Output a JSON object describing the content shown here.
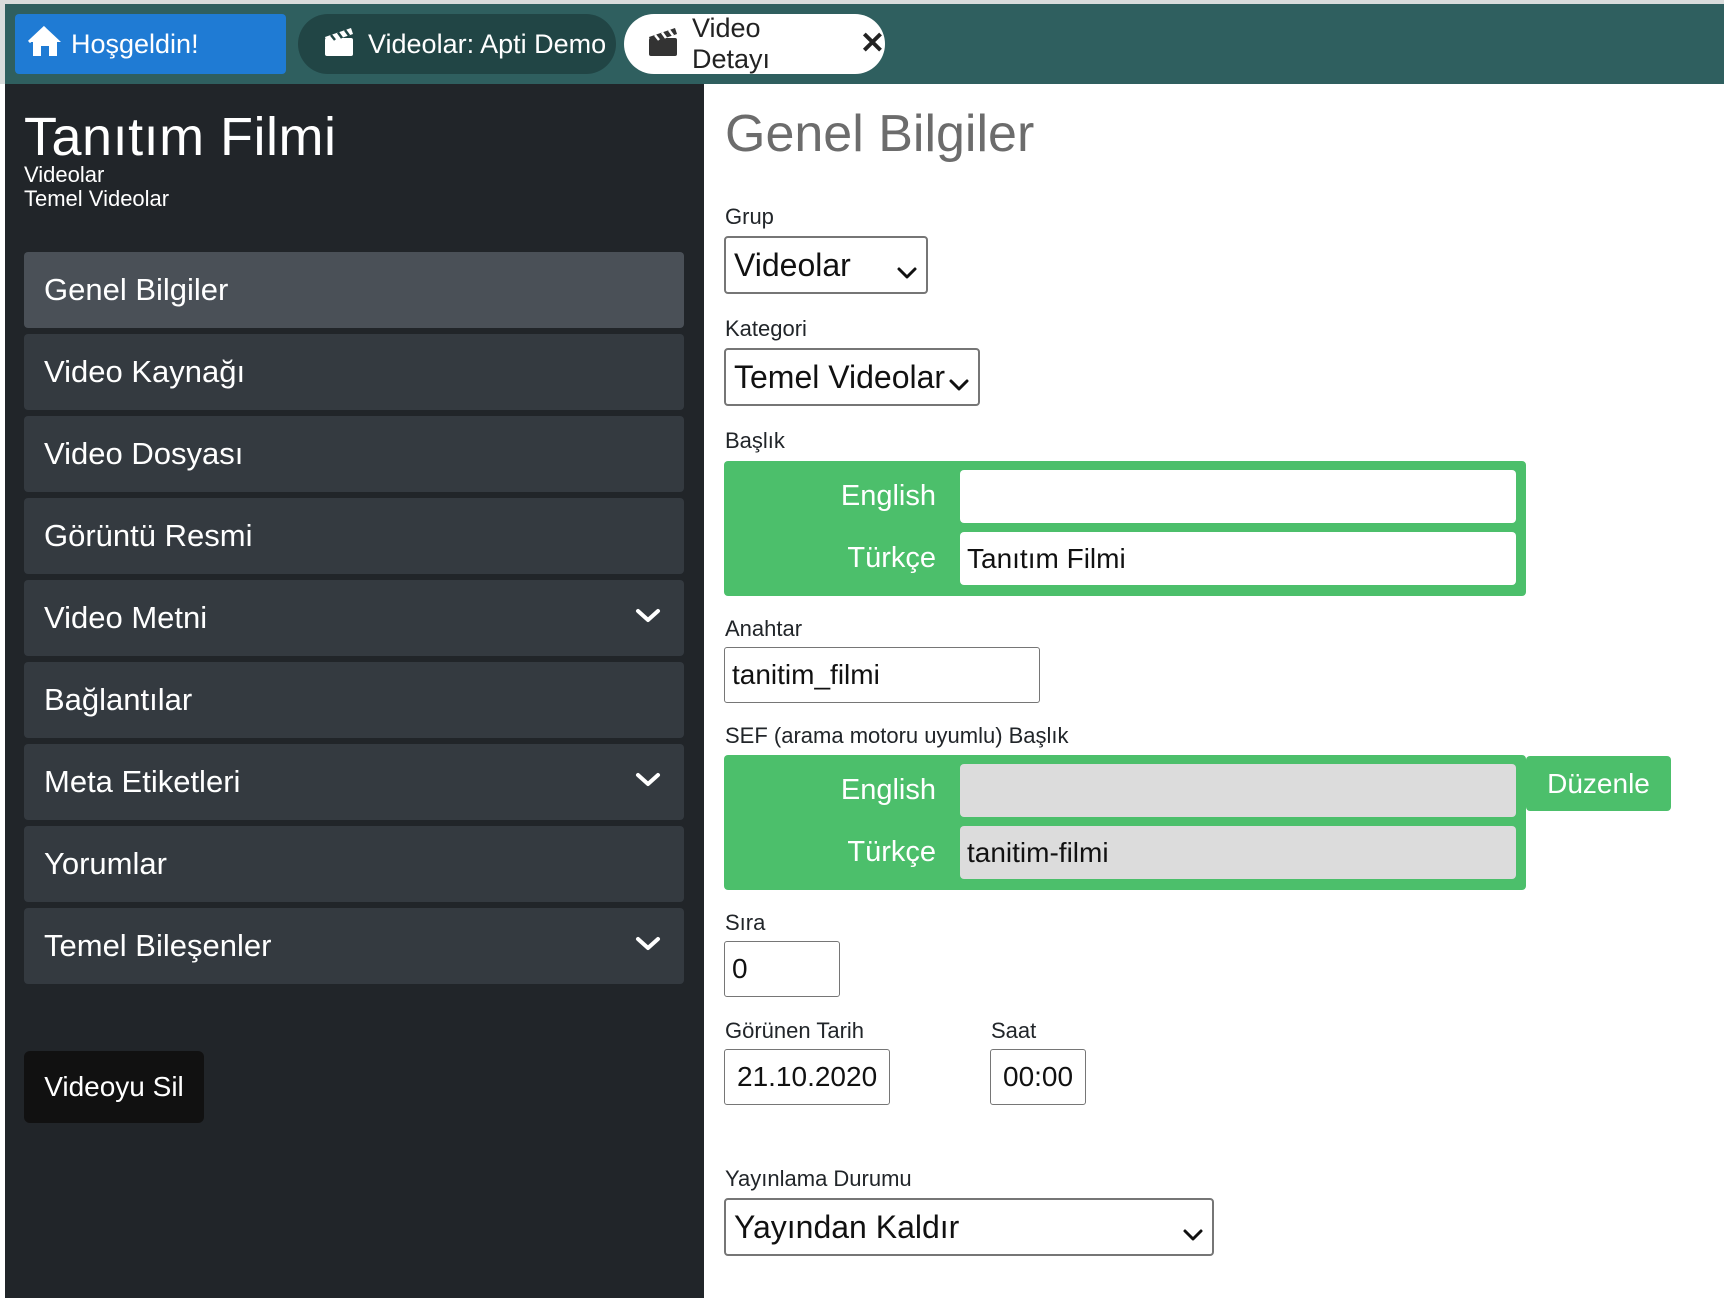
{
  "tabs": {
    "home": "Hoşgeldin!",
    "videos": "Videolar: Apti Demo",
    "detail": "Video Detayı",
    "detail_close": "✕"
  },
  "sidebar": {
    "title": "Tanıtım Filmi",
    "subtitle1": "Videolar",
    "subtitle2": "Temel Videolar",
    "items": [
      {
        "label": "Genel Bilgiler",
        "active": true
      },
      {
        "label": "Video Kaynağı"
      },
      {
        "label": "Video Dosyası"
      },
      {
        "label": "Görüntü Resmi"
      },
      {
        "label": "Video Metni",
        "expandable": true
      },
      {
        "label": "Bağlantılar"
      },
      {
        "label": "Meta Etiketleri",
        "expandable": true
      },
      {
        "label": "Yorumlar"
      },
      {
        "label": "Temel Bileşenler",
        "expandable": true
      }
    ],
    "delete_label": "Videoyu Sil"
  },
  "main": {
    "title": "Genel Bilgiler",
    "group": {
      "label": "Grup",
      "value": "Videolar"
    },
    "category": {
      "label": "Kategori",
      "value": "Temel Videolar"
    },
    "heading": {
      "label": "Başlık",
      "english_label": "English",
      "english_value": "",
      "turkish_label": "Türkçe",
      "turkish_value": "Tanıtım Filmi"
    },
    "key": {
      "label": "Anahtar",
      "value": "tanitim_filmi"
    },
    "sef": {
      "label": "SEF (arama motoru uyumlu) Başlık",
      "english_label": "English",
      "english_value": "",
      "turkish_label": "Türkçe",
      "turkish_value": "tanitim-filmi",
      "edit_label": "Düzenle"
    },
    "order": {
      "label": "Sıra",
      "value": "0"
    },
    "date": {
      "label": "Görünen Tarih",
      "value": "21.10.2020"
    },
    "time": {
      "label": "Saat",
      "value": "00:00"
    },
    "publish": {
      "label": "Yayınlama Durumu",
      "value": "Yayından Kaldır"
    }
  },
  "colors": {
    "topbar": "#2f5f5f",
    "home_tab": "#1f7bd4",
    "sidebar": "#212529",
    "menu_item": "#343a40",
    "menu_item_active": "#4a5057",
    "lang_box": "#4cbf6b"
  }
}
